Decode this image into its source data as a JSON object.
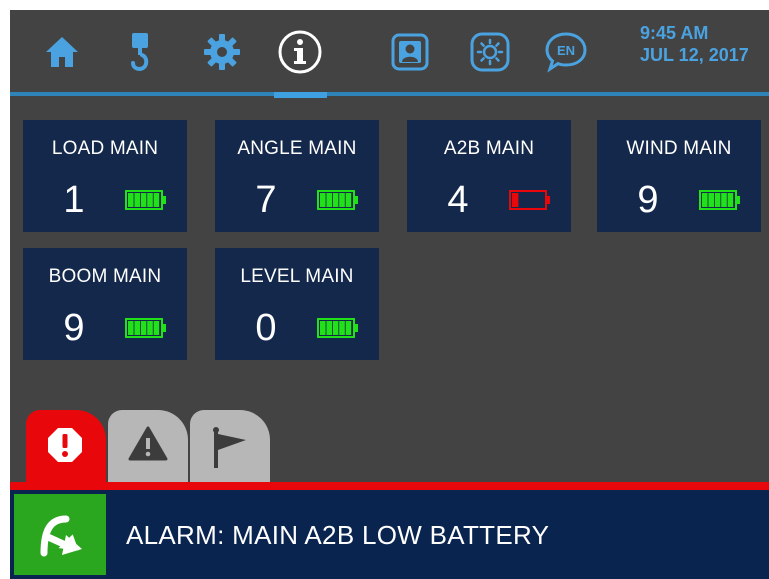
{
  "header": {
    "nav_items": [
      {
        "name": "home",
        "icon": "home-icon"
      },
      {
        "name": "crane-hook",
        "icon": "crane-hook-icon"
      },
      {
        "name": "settings",
        "icon": "gear-icon"
      },
      {
        "name": "info",
        "icon": "info-icon",
        "active": true
      },
      {
        "name": "operator",
        "icon": "operator-icon"
      },
      {
        "name": "brightness",
        "icon": "brightness-icon"
      },
      {
        "name": "language",
        "icon": "language-icon",
        "label": "EN"
      }
    ],
    "time": "9:45 AM",
    "date": "JUL 12, 2017"
  },
  "sensors": [
    {
      "name": "LOAD MAIN",
      "value": "1",
      "battery_level": 1.0,
      "battery_status": "good"
    },
    {
      "name": "ANGLE MAIN",
      "value": "7",
      "battery_level": 1.0,
      "battery_status": "good"
    },
    {
      "name": "A2B MAIN",
      "value": "4",
      "battery_level": 0.2,
      "battery_status": "low"
    },
    {
      "name": "WIND MAIN",
      "value": "9",
      "battery_level": 1.0,
      "battery_status": "good"
    },
    {
      "name": "BOOM MAIN",
      "value": "9",
      "battery_level": 1.0,
      "battery_status": "good"
    },
    {
      "name": "LEVEL MAIN",
      "value": "0",
      "battery_level": 1.0,
      "battery_status": "good"
    }
  ],
  "tabs": [
    {
      "name": "alarms",
      "icon": "alarm-octagon-icon",
      "active": true
    },
    {
      "name": "warnings",
      "icon": "warning-triangle-icon"
    },
    {
      "name": "flags",
      "icon": "flag-icon"
    }
  ],
  "alarm": {
    "message": "ALARM: MAIN A2B LOW BATTERY",
    "ack_icon": "acknowledge-arrow-icon"
  },
  "colors": {
    "background": "#434343",
    "tile": "#14284b",
    "accent_blue": "#2e84b8",
    "battery_good": "#22e01a",
    "battery_low": "#e8070b",
    "alarm_red": "#e8070b",
    "alarm_bar": "#0a2450",
    "ack_green": "#2ba61f"
  }
}
